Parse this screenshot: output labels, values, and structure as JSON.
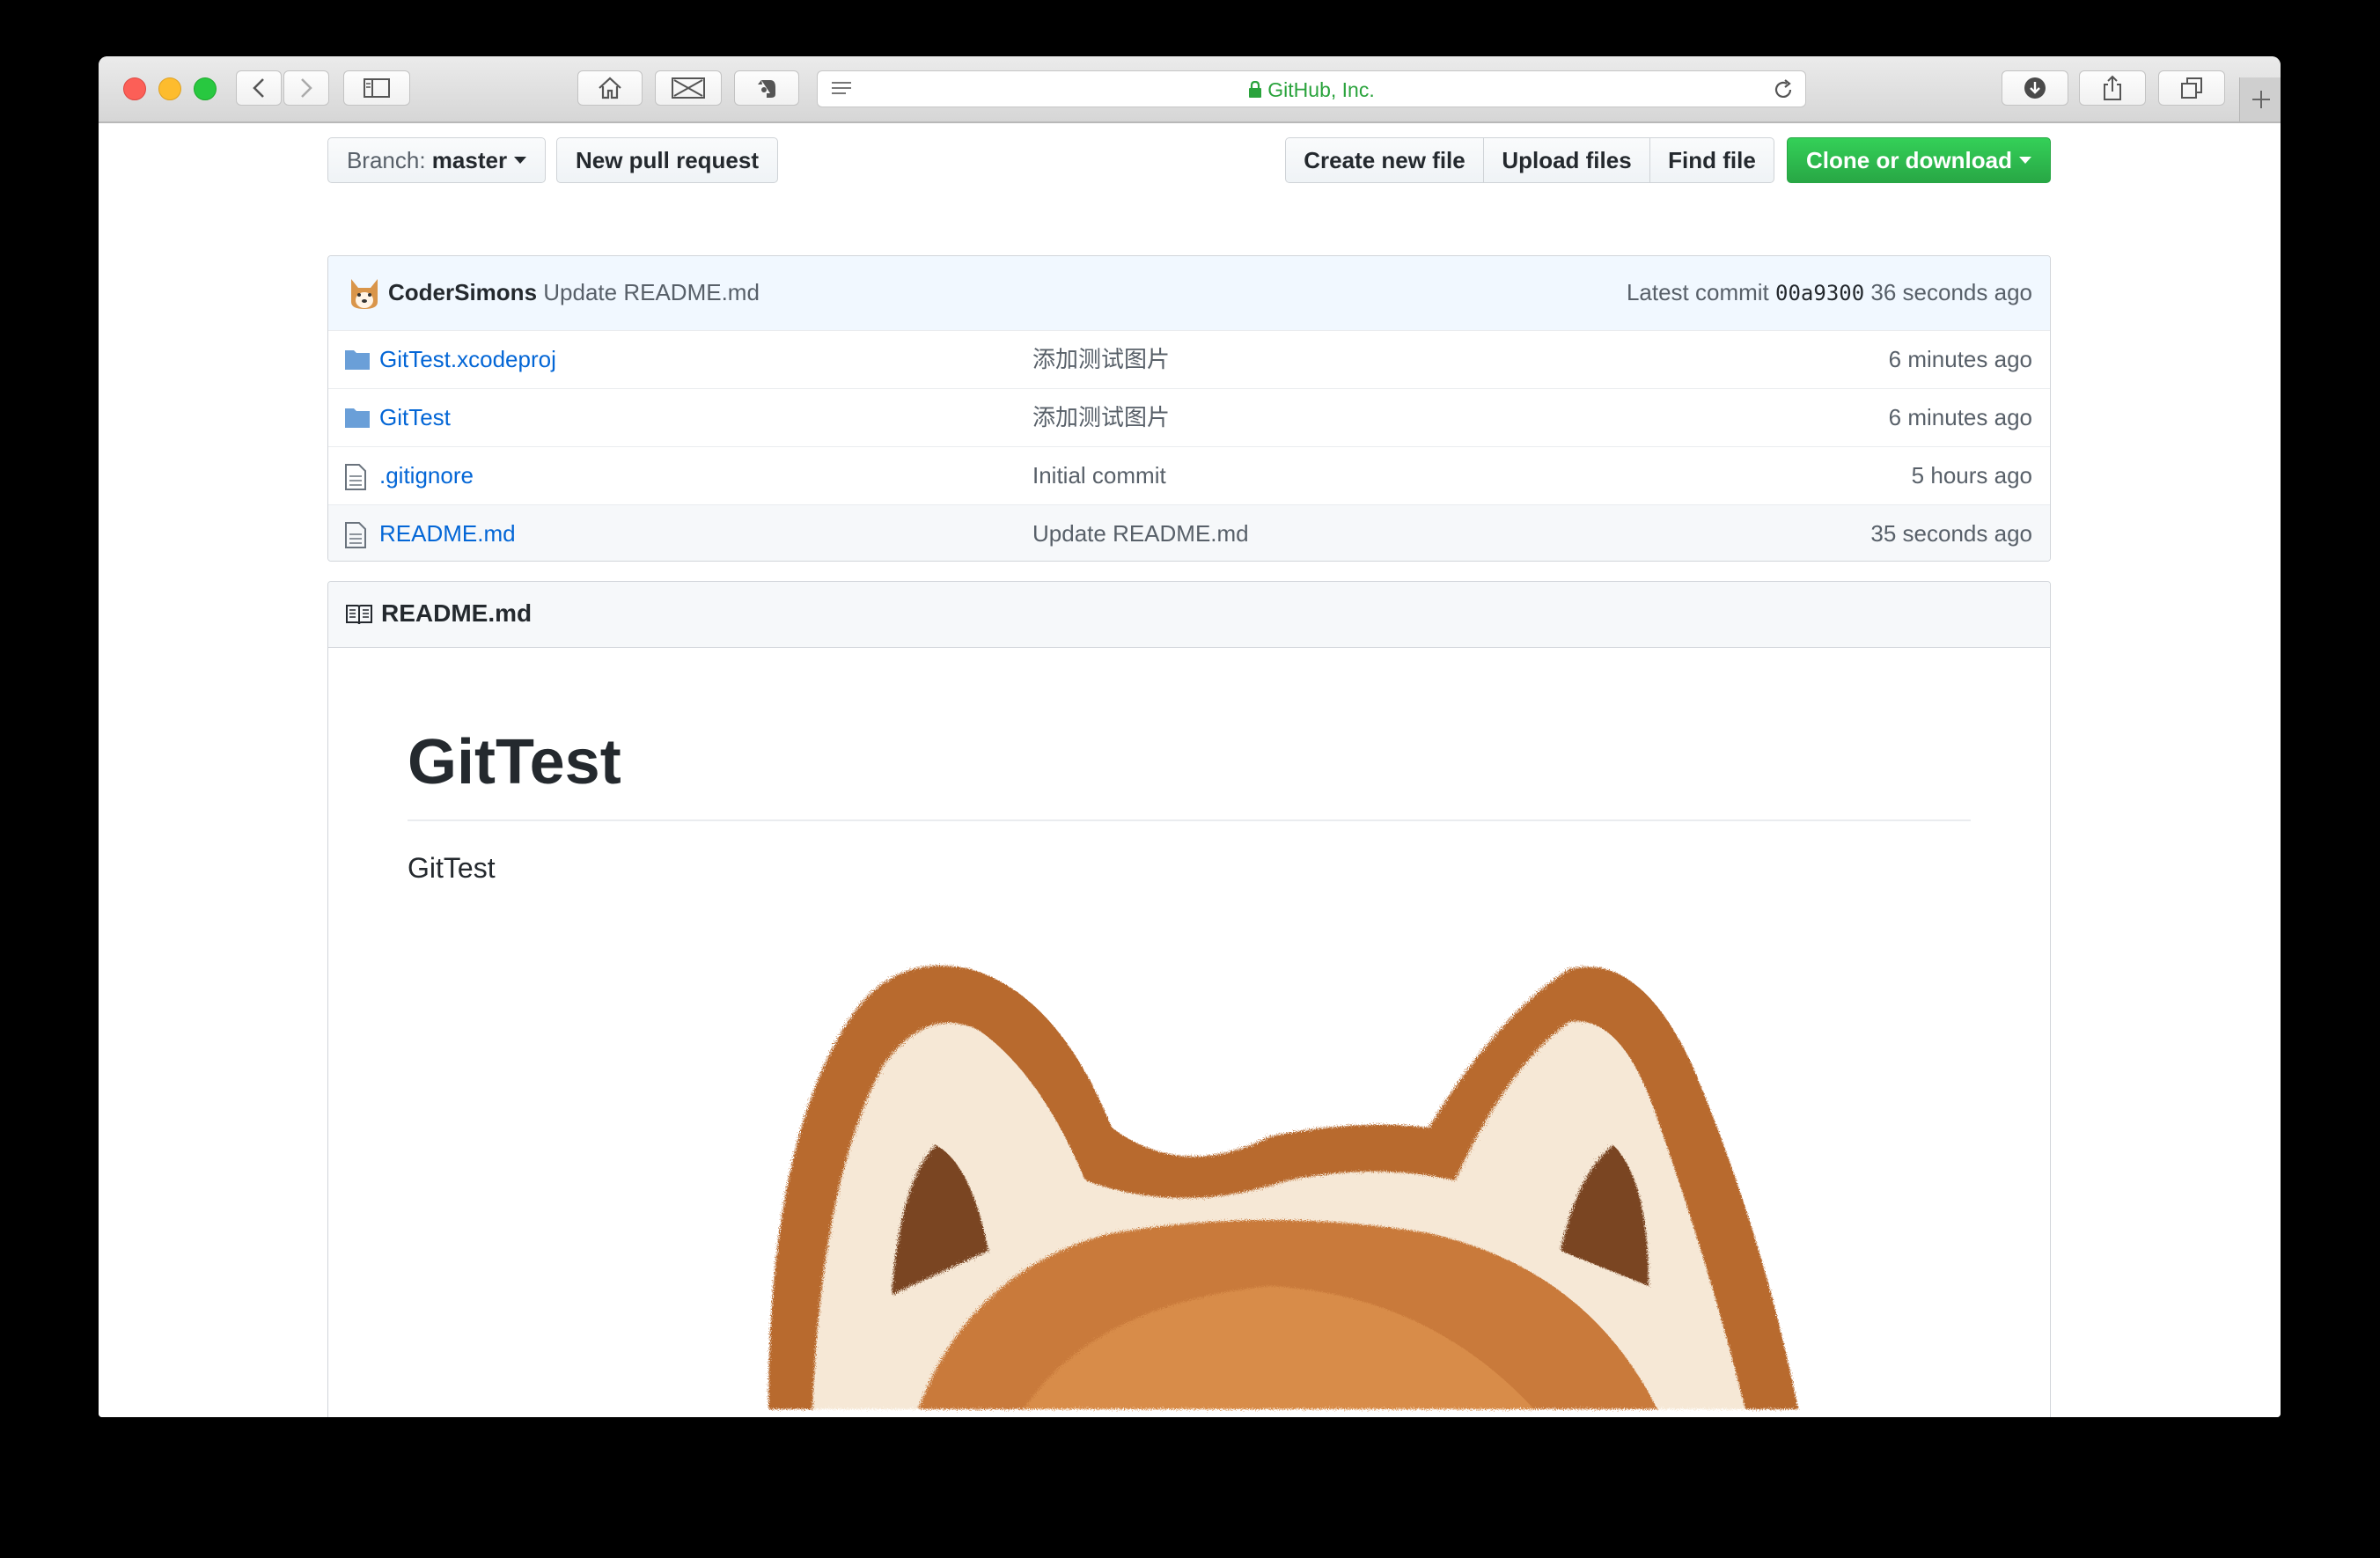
{
  "browser": {
    "address_text": "GitHub, Inc."
  },
  "repo_toolbar": {
    "branch_label": "Branch:",
    "branch_value": "master",
    "new_pull_request": "New pull request",
    "create_new_file": "Create new file",
    "upload_files": "Upload files",
    "find_file": "Find file",
    "clone_or_download": "Clone or download"
  },
  "latest_commit": {
    "author": "CoderSimons",
    "message": "Update README.md",
    "label": "Latest commit",
    "sha": "00a9300",
    "age": "36 seconds ago"
  },
  "files": [
    {
      "type": "folder",
      "name": "GitTest.xcodeproj",
      "message": "添加测试图片",
      "age": "6 minutes ago"
    },
    {
      "type": "folder",
      "name": "GitTest",
      "message": "添加测试图片",
      "age": "6 minutes ago"
    },
    {
      "type": "file",
      "name": ".gitignore",
      "message": "Initial commit",
      "age": "5 hours ago"
    },
    {
      "type": "file",
      "name": "README.md",
      "message": "Update README.md",
      "age": "35 seconds ago"
    }
  ],
  "readme": {
    "filename": "README.md",
    "heading": "GitTest",
    "paragraph": "GitTest"
  },
  "colors": {
    "url_green": "#2aa33c",
    "link_blue": "#0366d6",
    "clone_green": "#28a745",
    "folder_blue": "#79b8ff"
  }
}
